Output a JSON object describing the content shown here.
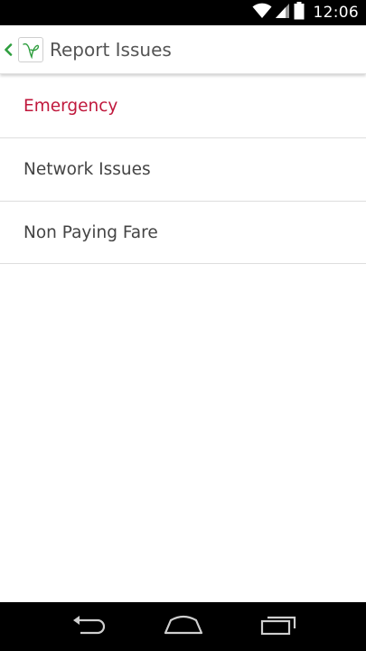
{
  "status_bar": {
    "time": "12:06",
    "icons": [
      "wifi-icon",
      "signal-icon",
      "battery-icon"
    ]
  },
  "action_bar": {
    "title": "Report Issues",
    "up_icon": "chevron-left-icon",
    "logo_icon": "app-logo-icon",
    "accent_color": "#2e9e3e"
  },
  "issues": {
    "items": [
      {
        "label": "Emergency",
        "color": "#c0183c"
      },
      {
        "label": "Network Issues",
        "color": "#444444"
      },
      {
        "label": "Non Paying Fare",
        "color": "#444444"
      }
    ]
  },
  "nav_bar": {
    "buttons": [
      "back-icon",
      "home-icon",
      "recents-icon"
    ]
  }
}
